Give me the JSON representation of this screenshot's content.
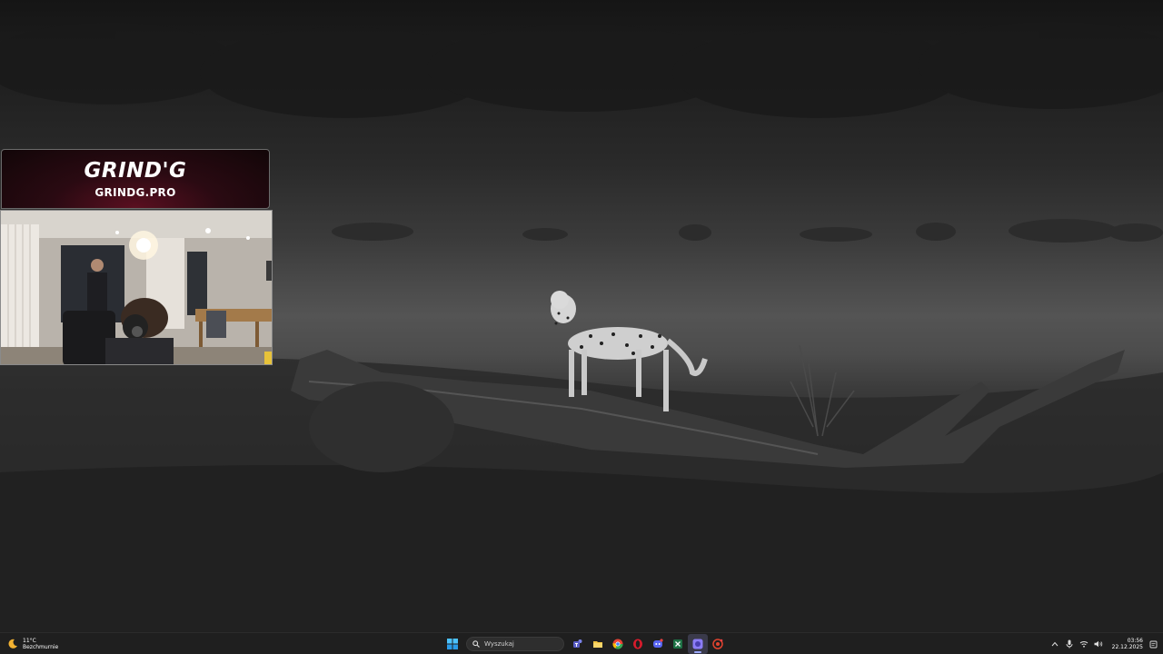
{
  "overlay": {
    "logo_main": "GRIND'G",
    "logo_sub": "GRINDG.PRO"
  },
  "taskbar": {
    "weather": {
      "temperature": "11°C",
      "condition": "Bezchmurnie",
      "icon": "moon-weather-icon"
    },
    "start_icon": "windows-start-icon",
    "search": {
      "placeholder": "Wyszukaj",
      "icon": "search-icon"
    },
    "pinned_apps": [
      {
        "name": "teams-icon",
        "color": "#7b83eb"
      },
      {
        "name": "file-explorer-icon",
        "color": "#f4c542"
      },
      {
        "name": "chrome-icon",
        "color": "#34a853"
      },
      {
        "name": "opera-icon",
        "color": "#d81b2c"
      },
      {
        "name": "discord-icon",
        "color": "#5865f2"
      },
      {
        "name": "excel-icon",
        "color": "#1e7145"
      },
      {
        "name": "obs-app-icon",
        "color": "#8b7cf6"
      },
      {
        "name": "recorder-app-icon",
        "color": "#e0432f"
      }
    ],
    "tray": {
      "chevron": "chevron-up-icon",
      "microphone": "microphone-icon",
      "network": "wifi-icon",
      "volume": "speaker-icon",
      "notification": "notification-icon"
    },
    "clock": {
      "time": "03:56",
      "date": "22.12.2025"
    }
  },
  "colors": {
    "taskbar_bg": "#1f1f1f",
    "logo_bg": "#2a0a12",
    "active_indicator": "#9aa7ff"
  }
}
